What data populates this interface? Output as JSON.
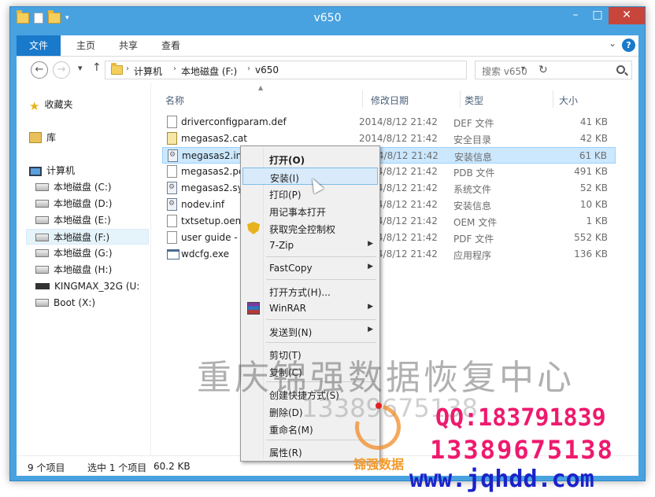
{
  "window": {
    "title": "v650"
  },
  "ribbon": {
    "tabs": [
      "文件",
      "主页",
      "共享",
      "查看"
    ],
    "help": "?"
  },
  "address": {
    "crumbs": [
      "计算机",
      "本地磁盘 (F:)",
      "v650"
    ]
  },
  "search": {
    "placeholder": "搜索 v650"
  },
  "nav": {
    "favorites": "收藏夹",
    "library": "库",
    "computer": "计算机",
    "drives": [
      "本地磁盘 (C:)",
      "本地磁盘 (D:)",
      "本地磁盘 (E:)",
      "本地磁盘 (F:)",
      "本地磁盘 (G:)",
      "本地磁盘 (H:)",
      "KINGMAX_32G (U:",
      "Boot (X:)"
    ]
  },
  "columns": {
    "name": "名称",
    "date": "修改日期",
    "type": "类型",
    "size": "大小"
  },
  "files": [
    {
      "name": "driverconfigparam.def",
      "date": "2014/8/12 21:42",
      "type": "DEF 文件",
      "size": "41 KB",
      "icon": "generic-file-icon"
    },
    {
      "name": "megasas2.cat",
      "date": "2014/8/12 21:42",
      "type": "安全目录",
      "size": "42 KB",
      "icon": "catalog-file-icon"
    },
    {
      "name": "megasas2.inf",
      "date": "2014/8/12 21:42",
      "type": "安装信息",
      "size": "61 KB",
      "icon": "setup-info-icon"
    },
    {
      "name": "megasas2.pdb",
      "date": "2014/8/12 21:42",
      "type": "PDB 文件",
      "size": "491 KB",
      "icon": "generic-file-icon"
    },
    {
      "name": "megasas2.sys",
      "date": "2014/8/12 21:42",
      "type": "系统文件",
      "size": "52 KB",
      "icon": "system-file-icon"
    },
    {
      "name": "nodev.inf",
      "date": "2014/8/12 21:42",
      "type": "安装信息",
      "size": "10 KB",
      "icon": "setup-info-icon"
    },
    {
      "name": "txtsetup.oem",
      "date": "2014/8/12 21:42",
      "type": "OEM 文件",
      "size": "1 KB",
      "icon": "generic-file-icon"
    },
    {
      "name": "user guide - wi",
      "date": "2014/8/12 21:42",
      "type": "PDF 文件",
      "size": "552 KB",
      "icon": "pdf-file-icon"
    },
    {
      "name": "wdcfg.exe",
      "date": "2014/8/12 21:42",
      "type": "应用程序",
      "size": "136 KB",
      "icon": "application-icon"
    }
  ],
  "status": {
    "count": "9 个项目",
    "selected": "选中 1 个项目",
    "size": "60.2 KB"
  },
  "context_menu": {
    "items": [
      "打开(O)",
      "安装(I)",
      "打印(P)",
      "用记事本打开",
      "获取完全控制权",
      "7-Zip",
      "FastCopy",
      "打开方式(H)...",
      "WinRAR",
      "发送到(N)",
      "剪切(T)",
      "复制(C)",
      "创建快捷方式(S)",
      "删除(D)",
      "重命名(M)",
      "属性(R)"
    ]
  },
  "watermark": {
    "company": "重庆锦强数据恢复中心",
    "phone_faint": "13389675138",
    "qq": "QQ:183791839",
    "phone": "13389675138",
    "url": "www.jqhdd.com",
    "logo_text": "锦强数据"
  },
  "colors": {
    "accent": "#1979ca",
    "close": "#c7453b",
    "watermark_pink": "#ee1a6e",
    "watermark_blue": "#1b22c8"
  }
}
